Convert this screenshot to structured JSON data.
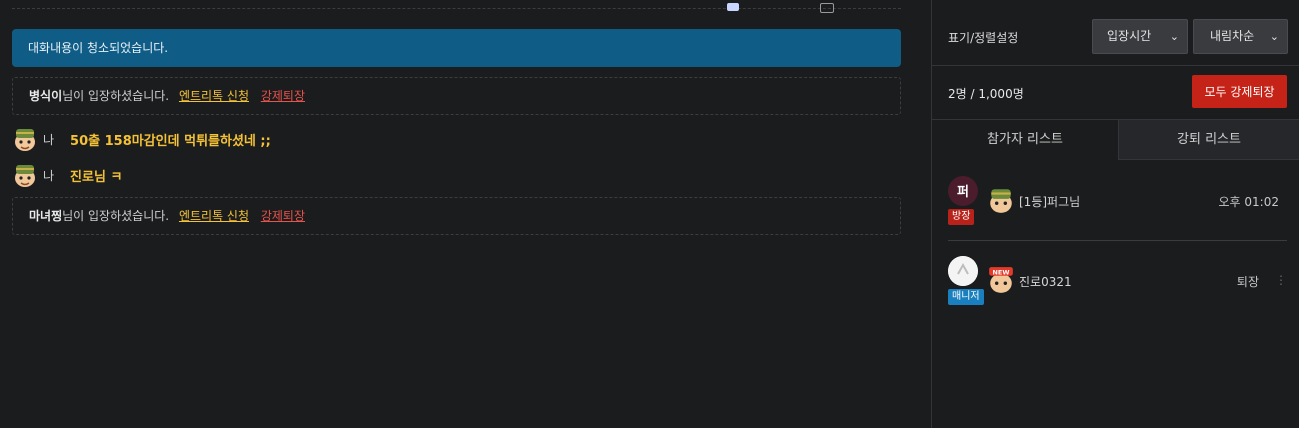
{
  "chat": {
    "notice": "대화내용이 청소되었습니다.",
    "system_messages": [
      {
        "user": "병식이",
        "text": "님이 입장하셨습니다.",
        "entry_link": "엔트리톡 신청",
        "kick_link": "강제퇴장"
      },
      {
        "user": "마녀찡",
        "text": "님이 입장하셨습니다.",
        "entry_link": "엔트리톡 신청",
        "kick_link": "강제퇴장"
      }
    ],
    "messages": [
      {
        "sender": "나",
        "text": "50출 158마감인데 먹튀를하셨네 ;;"
      },
      {
        "sender": "나",
        "text": "진로님 ㅋ"
      }
    ]
  },
  "sidebar": {
    "display_setting_label": "표기/정렬설정",
    "sort_select": {
      "value": "입장시간"
    },
    "order_select": {
      "value": "내림차순"
    },
    "count": "2명 / 1,000명",
    "kick_all_button": "모두 강제퇴장",
    "tabs": [
      {
        "label": "참가자 리스트"
      },
      {
        "label": "강퇴 리스트"
      }
    ],
    "participants": [
      {
        "role": "방장",
        "role_color": "#b8221b",
        "name": "[1등]퍼그님",
        "right_text": "오후 01:02"
      },
      {
        "role": "매니저",
        "role_color": "#1a7fbf",
        "name": "진로0321",
        "right_text": "퇴장"
      }
    ]
  }
}
